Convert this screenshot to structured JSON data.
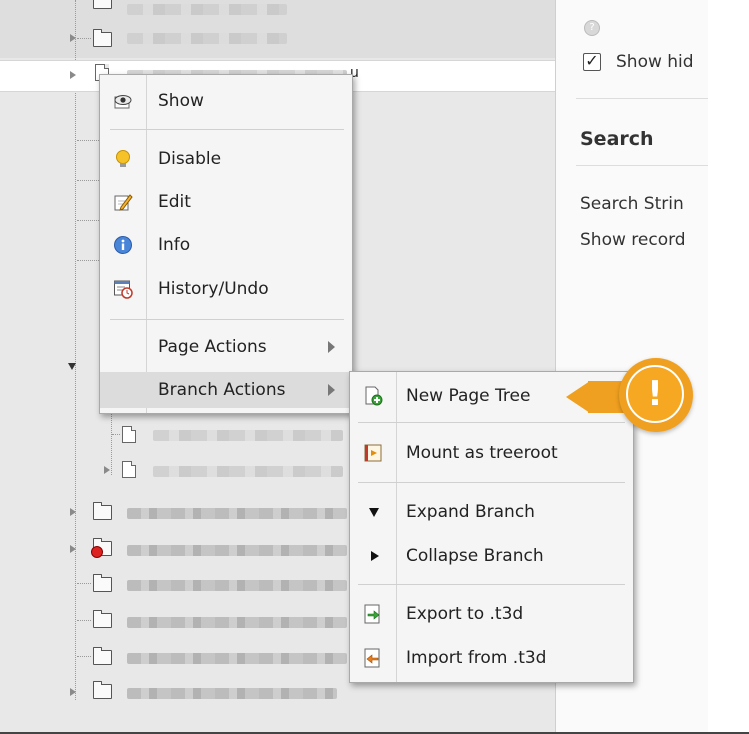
{
  "tree": {
    "partial_label": "u"
  },
  "right_panel": {
    "help_icon": "help-icon",
    "show_hidden_label": "Show hid",
    "search_heading": "Search",
    "search_string_label": "Search Strin",
    "show_records_label": "Show record"
  },
  "context_menu": {
    "items": [
      {
        "label": "Show",
        "icon": "eye-icon"
      },
      {
        "label": "Disable",
        "icon": "lightbulb-icon"
      },
      {
        "label": "Edit",
        "icon": "pencil-icon"
      },
      {
        "label": "Info",
        "icon": "info-icon"
      },
      {
        "label": "History/Undo",
        "icon": "history-icon"
      },
      {
        "label": "Page Actions",
        "icon": "submenu-arrow"
      },
      {
        "label": "Branch Actions",
        "icon": "submenu-arrow"
      }
    ]
  },
  "submenu": {
    "items": [
      {
        "label": "New Page Tree",
        "icon": "new-page-tree-icon"
      },
      {
        "label": "Mount as treeroot",
        "icon": "mount-icon"
      },
      {
        "label": "Expand Branch",
        "icon": "expand-icon"
      },
      {
        "label": "Collapse Branch",
        "icon": "collapse-icon"
      },
      {
        "label": "Export to .t3d",
        "icon": "export-icon"
      },
      {
        "label": "Import from .t3d",
        "icon": "import-icon"
      }
    ]
  },
  "callout": {
    "symbol": "!",
    "color": "#f0a020"
  },
  "colors": {
    "tree_bg": "#e8e8e8",
    "menu_bg": "#f5f5f5",
    "menu_highlight": "#dcdcdc"
  }
}
